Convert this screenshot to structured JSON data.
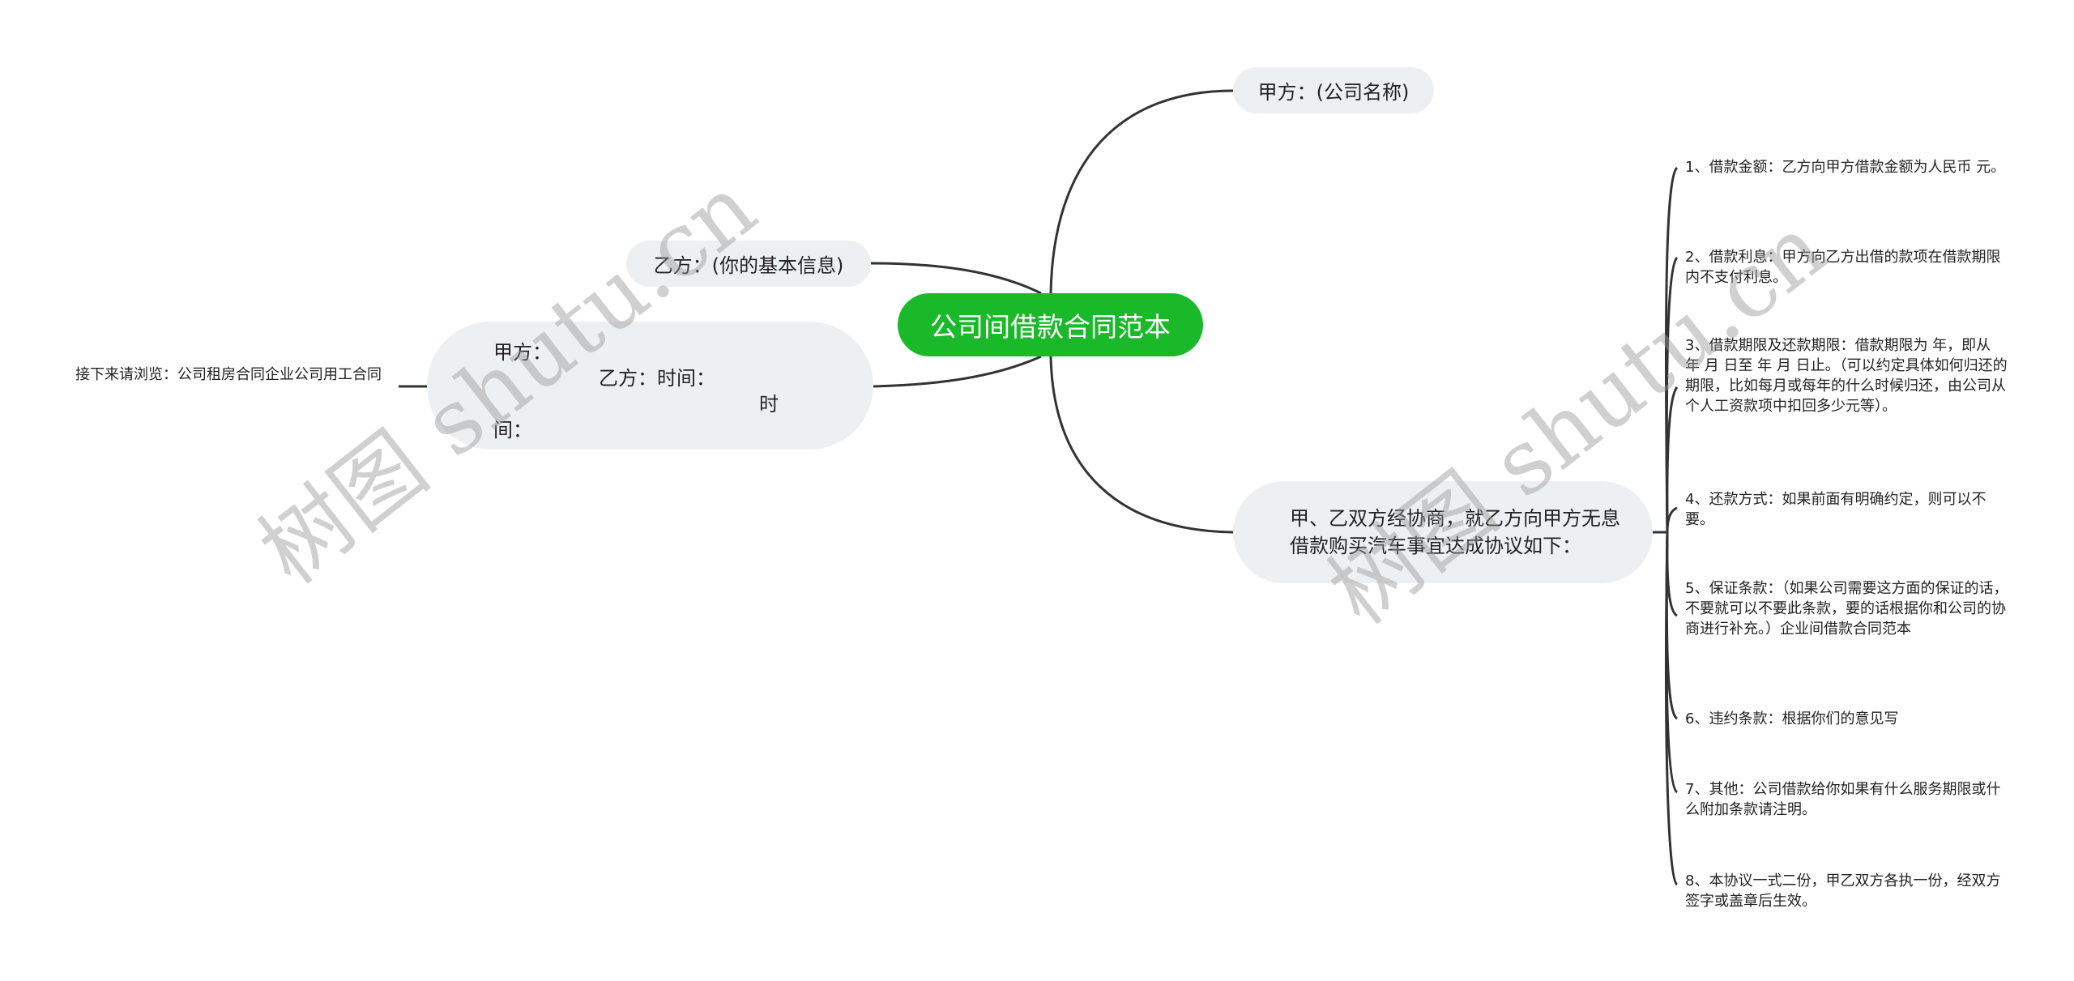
{
  "root": {
    "label": "公司间借款合同范本",
    "color": "#1ab92a"
  },
  "branches": {
    "party_a": "甲方：(公司名称)",
    "party_b": "乙方：(你的基本信息)",
    "info": {
      "line1": "甲方：",
      "line2": "乙方：时间：",
      "line3": "时",
      "line4": "间："
    },
    "agreement": "甲、乙双方经协商，就乙方向甲方无息借款购买汽车事宜达成协议如下："
  },
  "left_leaf": "接下来请浏览：公司租房合同企业公司用工合同",
  "clauses": [
    "1、借款金额：乙方向甲方借款金额为人民币 元。",
    "2、借款利息：甲方向乙方出借的款项在借款期限内不支付利息。",
    "3、借款期限及还款期限：借款期限为 年，即从 年 月 日至 年 月 日止。（可以约定具体如何归还的期限，比如每月或每年的什么时候归还，由公司从个人工资款项中扣回多少元等）。",
    "4、还款方式：如果前面有明确约定，则可以不要。",
    "5、保证条款：（如果公司需要这方面的保证的话，不要就可以不要此条款，要的话根据你和公司的协商进行补充。）企业间借款合同范本",
    "6、违约条款：根据你们的意见写",
    "7、其他：公司借款给你如果有什么服务期限或什么附加条款请注明。",
    "8、本协议一式二份，甲乙双方各执一份，经双方签字或盖章后生效。"
  ],
  "watermark": "树图 shutu.cn"
}
